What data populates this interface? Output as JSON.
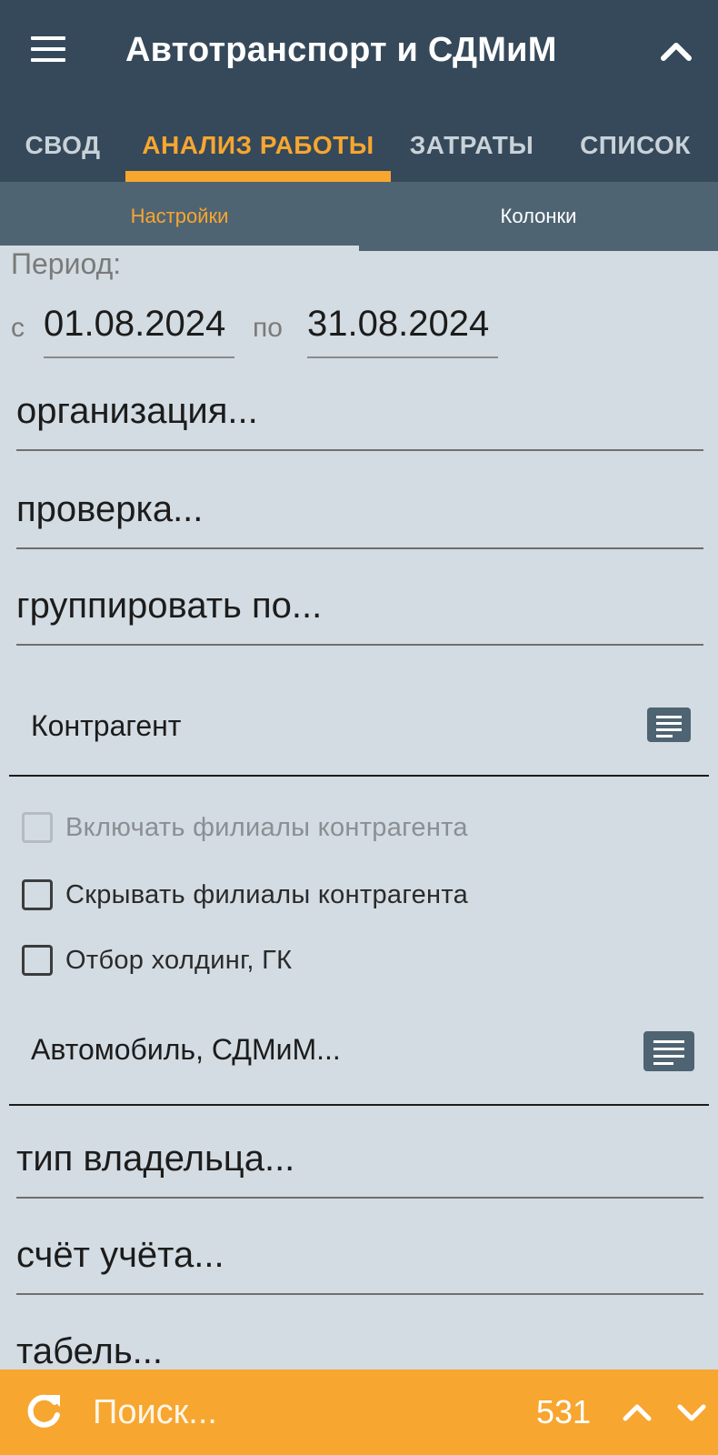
{
  "header": {
    "title": "Автотранспорт и СДМиМ",
    "menu_icon": "hamburger-menu-icon",
    "collapse_icon": "chevron-up-icon"
  },
  "tabs": [
    {
      "label": "СВОД",
      "active": false
    },
    {
      "label": "АНАЛИЗ РАБОТЫ",
      "active": true
    },
    {
      "label": "ЗАТРАТЫ",
      "active": false
    },
    {
      "label": "СПИСОК",
      "active": false
    }
  ],
  "subtabs": [
    {
      "label": "Настройки",
      "active": true
    },
    {
      "label": "Колонки",
      "active": false
    }
  ],
  "period": {
    "label": "Период:",
    "from_label": "с",
    "from": "01.08.2024",
    "to_label": "по",
    "to": "31.08.2024"
  },
  "fields": {
    "organization": "организация...",
    "check": "проверка...",
    "group_by": "группировать по...",
    "owner_type": "тип владельца...",
    "account": "счёт учёта...",
    "timesheet": "табель..."
  },
  "selects": {
    "counterparty": "Контрагент",
    "vehicle": "Автомобиль, СДМиМ..."
  },
  "checkboxes": [
    {
      "label": "Включать филиалы контрагента",
      "checked": false,
      "disabled": true
    },
    {
      "label": "Скрывать филиалы контрагента",
      "checked": false,
      "disabled": false
    },
    {
      "label": "Отбор холдинг, ГК",
      "checked": false,
      "disabled": false
    }
  ],
  "bottom": {
    "search_placeholder": "Поиск...",
    "count": "531"
  },
  "colors": {
    "header_bg": "#35495a",
    "accent": "#f7a630",
    "subtab_bg": "#4f6472",
    "content_bg": "#d3dce2"
  }
}
